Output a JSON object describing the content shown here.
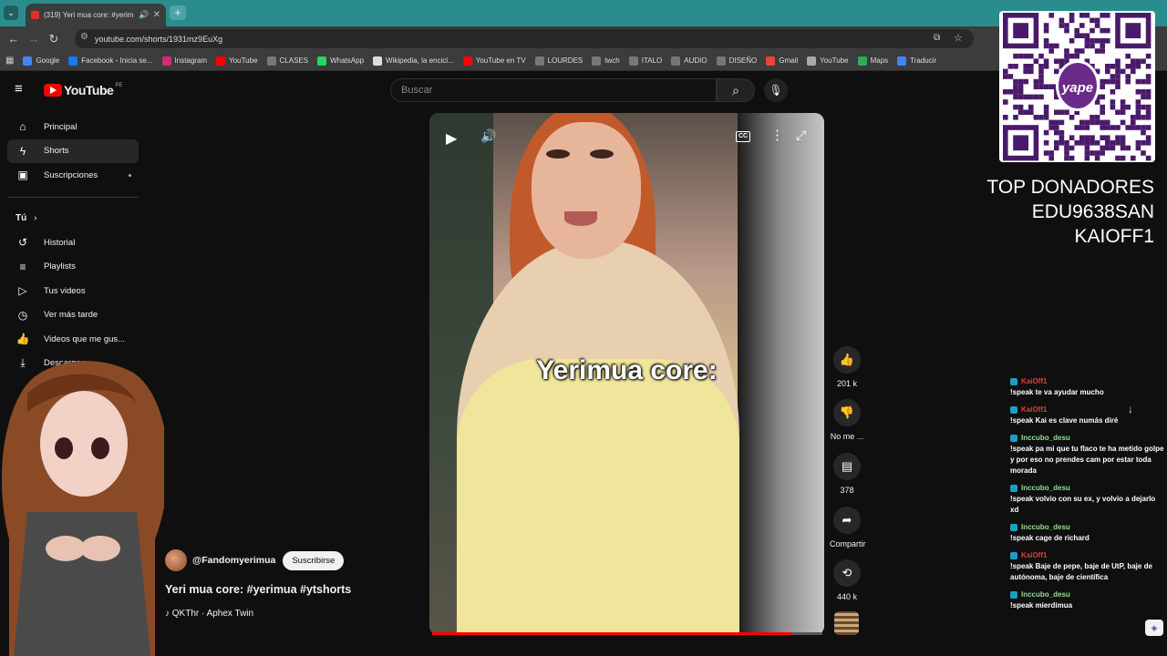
{
  "browser": {
    "tab_title": "(319) Yeri mua core: #yerim",
    "url": "youtube.com/shorts/1931mz9EuXg",
    "bookmarks": [
      {
        "label": "Google",
        "color": "#4285f4"
      },
      {
        "label": "Facebook - Inicia se...",
        "color": "#1877f2"
      },
      {
        "label": "Instagram",
        "color": "#d62976"
      },
      {
        "label": "YouTube",
        "color": "#ff0000"
      },
      {
        "label": "CLASES",
        "color": "#777777"
      },
      {
        "label": "WhatsApp",
        "color": "#25d366"
      },
      {
        "label": "Wikipedia, la encicl...",
        "color": "#dddddd"
      },
      {
        "label": "YouTube en TV",
        "color": "#ff0000"
      },
      {
        "label": "LOURDES",
        "color": "#777777"
      },
      {
        "label": "twch",
        "color": "#777777"
      },
      {
        "label": "ITALO",
        "color": "#777777"
      },
      {
        "label": "AUDIO",
        "color": "#777777"
      },
      {
        "label": "DISEÑO",
        "color": "#777777"
      },
      {
        "label": "Gmail",
        "color": "#ea4335"
      },
      {
        "label": "YouTube",
        "color": "#aaaaaa"
      },
      {
        "label": "Maps",
        "color": "#34a853"
      },
      {
        "label": "Traducir",
        "color": "#4285f4"
      }
    ]
  },
  "header": {
    "logo_text": "YouTube",
    "country_code": "PE",
    "search_placeholder": "Buscar"
  },
  "sidebar": {
    "items": [
      {
        "label": "Principal",
        "icon": "home-icon",
        "glyph": "⌂"
      },
      {
        "label": "Shorts",
        "icon": "shorts-icon",
        "glyph": "ϟ"
      },
      {
        "label": "Suscripciones",
        "icon": "subscriptions-icon",
        "glyph": "▣"
      }
    ],
    "you_label": "Tú",
    "you_items": [
      {
        "label": "Historial",
        "icon": "history-icon",
        "glyph": "↺"
      },
      {
        "label": "Playlists",
        "icon": "playlists-icon",
        "glyph": "≡"
      },
      {
        "label": "Tus videos",
        "icon": "your-videos-icon",
        "glyph": "▷"
      },
      {
        "label": "Ver más tarde",
        "icon": "watch-later-icon",
        "glyph": "◷"
      },
      {
        "label": "Videos que me gus...",
        "icon": "liked-videos-icon",
        "glyph": "👍"
      },
      {
        "label": "Descargas",
        "icon": "downloads-icon",
        "glyph": "⤓"
      }
    ]
  },
  "video": {
    "caption": "Yerimua core:",
    "progress": 0.92
  },
  "short": {
    "channel": "@Fandomyerimua",
    "subscribe_label": "Suscribirse",
    "title": "Yeri mua core: #yerimua #ytshorts",
    "music": "QKThr · Aphex Twin"
  },
  "actions": {
    "like_count": "201 k",
    "dislike_label": "No me ...",
    "comment_count": "378",
    "share_label": "Compartir",
    "remix_count": "440 k"
  },
  "overlay": {
    "qr_brand": "yape",
    "donors_title": "TOP DONADORES",
    "donors": [
      "EDU9638SAN",
      "KAIOFF1"
    ]
  },
  "chat": [
    {
      "user": "KaiOff1",
      "color": "#e23b3b",
      "text": "!speak te va ayudar mucho"
    },
    {
      "user": "KaiOff1",
      "color": "#e23b3b",
      "text": "!speak Kai es clave numás diré"
    },
    {
      "user": "Inccubo_desu",
      "color": "#8fe08f",
      "text": "!speak pa mi que tu flaco te ha metido golpe y por eso no prendes cam por estar toda morada"
    },
    {
      "user": "Inccubo_desu",
      "color": "#8fe08f",
      "text": "!speak volvio con su ex, y volvio a dejarlo xd"
    },
    {
      "user": "Inccubo_desu",
      "color": "#8fe08f",
      "text": "!speak cage de richard"
    },
    {
      "user": "KaiOff1",
      "color": "#e23b3b",
      "text": "!speak Baje de pepe, baje de UtP, baje de autónoma, baje de científica"
    },
    {
      "user": "Inccubo_desu",
      "color": "#8fe08f",
      "text": "!speak mierdimua"
    }
  ]
}
